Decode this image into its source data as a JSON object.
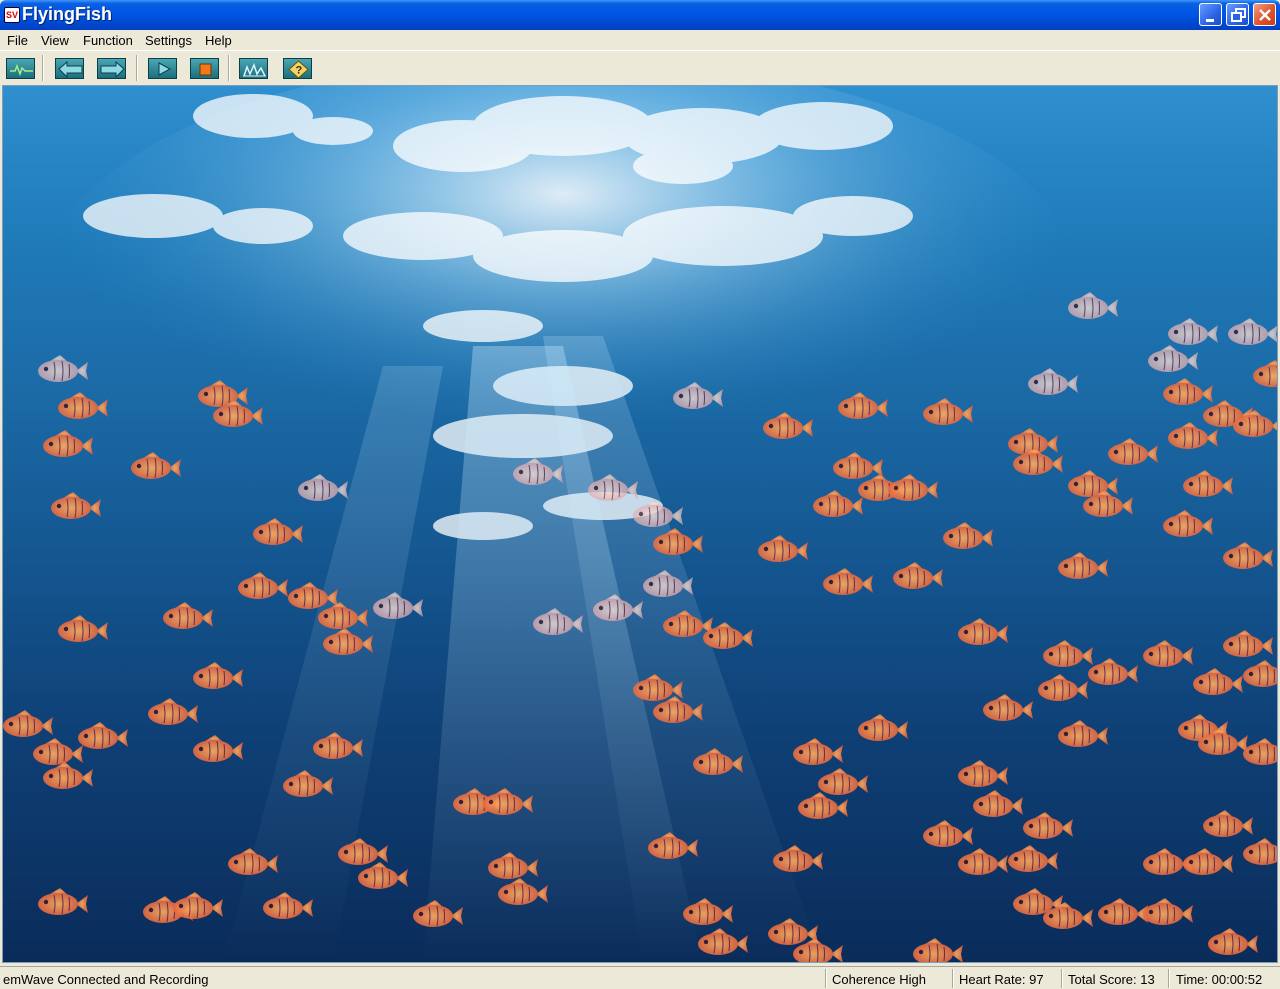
{
  "window": {
    "title": "FlyingFish",
    "controls": {
      "minimize": "minimize",
      "maximize": "restore",
      "close": "close"
    }
  },
  "menu": {
    "items": [
      {
        "label": "File"
      },
      {
        "label": "View"
      },
      {
        "label": "Function"
      },
      {
        "label": "Settings"
      },
      {
        "label": "Help"
      }
    ]
  },
  "toolbar": {
    "buttons": [
      {
        "icon": "heart-rhythm-icon"
      },
      {
        "icon": "arrow-left-icon"
      },
      {
        "icon": "arrow-right-icon"
      },
      {
        "icon": "play-icon"
      },
      {
        "icon": "stop-icon"
      },
      {
        "icon": "chart-icon"
      },
      {
        "icon": "help-icon"
      }
    ]
  },
  "scene": {
    "description_icon": "underwater-fish-game",
    "colors": {
      "water_top": "#2f8fcf",
      "water_bottom": "#0a2c5a",
      "fish": "#e87a40"
    }
  },
  "status": {
    "connection": "emWave Connected and Recording",
    "coherence": "Coherence High",
    "heart_rate": "Heart Rate: 97",
    "total_score": "Total Score: 13",
    "time": "Time: 00:00:52"
  }
}
